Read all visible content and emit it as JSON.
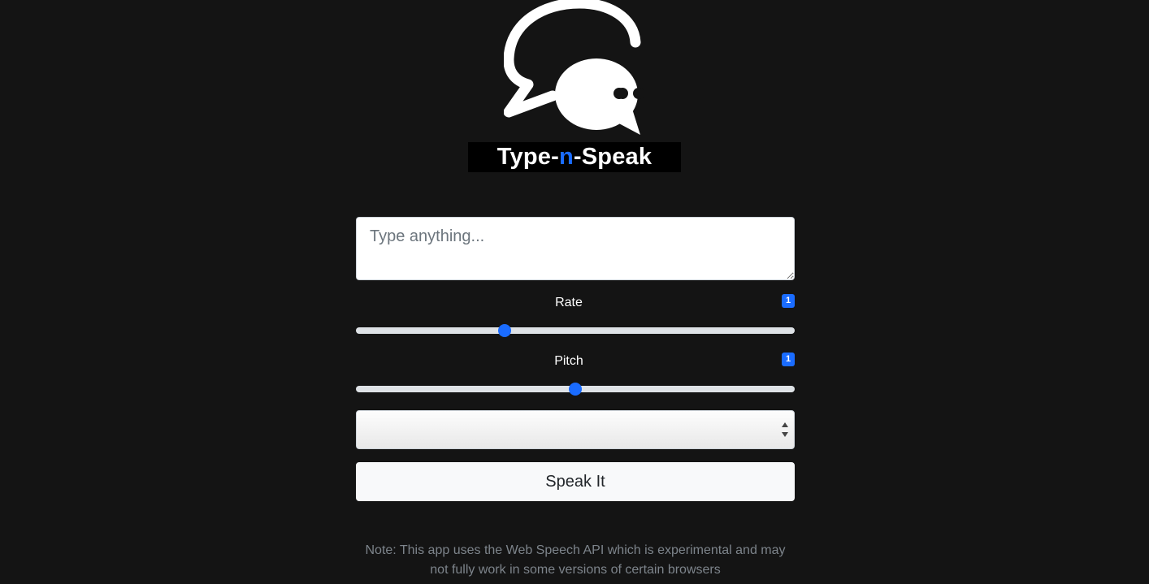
{
  "app": {
    "title_prefix": "Type-",
    "title_accent": "n",
    "title_suffix": "-Speak",
    "accent_color": "#1a6cff",
    "logo_icon": "speech-bubbles-icon"
  },
  "form": {
    "text_input": {
      "placeholder": "Type anything...",
      "value": ""
    },
    "rate": {
      "label": "Rate",
      "value": "1",
      "min": 0.5,
      "max": 2,
      "current": 1
    },
    "pitch": {
      "label": "Pitch",
      "value": "1",
      "min": 0,
      "max": 2,
      "current": 1
    },
    "voice_select": {
      "selected": ""
    },
    "speak_button_label": "Speak It"
  },
  "footer": {
    "note": "Note: This app uses the Web Speech API which is experimental and may not fully work in some versions of certain browsers"
  }
}
